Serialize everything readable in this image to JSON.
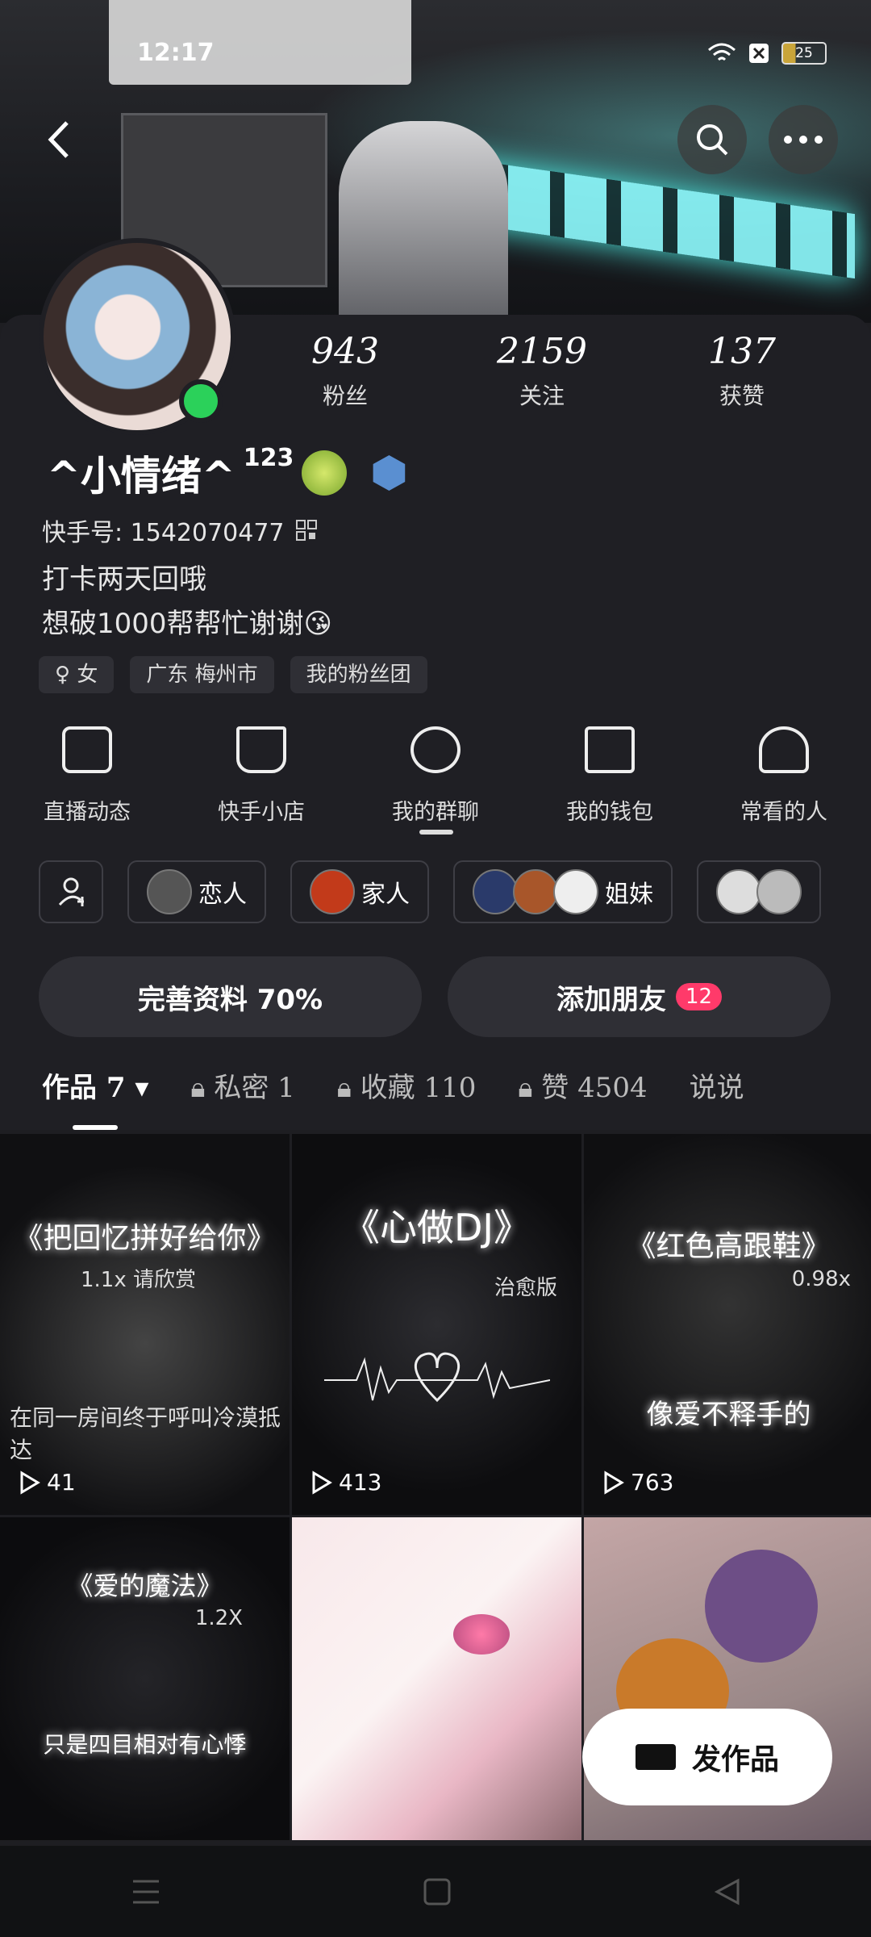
{
  "status": {
    "time": "12:17",
    "battery": "25"
  },
  "profile": {
    "followers_count": "943",
    "followers_label": "粉丝",
    "following_count": "2159",
    "following_label": "关注",
    "likes_count": "137",
    "likes_label": "获赞",
    "name": "^小情绪^",
    "name_suffix": "123",
    "kuaishou_id": "快手号: 1542070477",
    "bio_line1": "打卡两天回哦",
    "bio_line2": "想破1000帮帮忙谢谢😘",
    "tags": [
      "女",
      "广东 梅州市",
      "我的粉丝团"
    ]
  },
  "functions": [
    {
      "label": "直播动态",
      "icon": "live-camera-icon"
    },
    {
      "label": "快手小店",
      "icon": "shopping-cart-icon"
    },
    {
      "label": "我的群聊",
      "icon": "group-chat-icon"
    },
    {
      "label": "我的钱包",
      "icon": "wallet-icon"
    },
    {
      "label": "常看的人",
      "icon": "frequent-person-icon"
    }
  ],
  "groups": [
    {
      "label": "恋人"
    },
    {
      "label": "家人"
    },
    {
      "label": "姐妹"
    }
  ],
  "buttons": {
    "complete_profile": "完善资料 70%",
    "add_friend": "添加朋友",
    "add_friend_badge": "12"
  },
  "tabs": [
    {
      "label": "作品 7"
    },
    {
      "label": "私密 1"
    },
    {
      "label": "收藏 110"
    },
    {
      "label": "赞 4504"
    },
    {
      "label": "说说"
    }
  ],
  "videos": [
    {
      "title": "《把回忆拼好给你》",
      "sub": "1.1x 请欣赏",
      "bottom": "在同一房间终于呼叫冷漠抵达",
      "views": "41"
    },
    {
      "title": "《心做DJ》",
      "sub": "治愈版",
      "bottom": "",
      "views": "413"
    },
    {
      "title": "《红色高跟鞋》",
      "sub": "0.98x",
      "bottom": "像爱不释手的",
      "views": "763"
    },
    {
      "title": "《爱的魔法》",
      "sub": "1.2X",
      "bottom": "只是四目相对有心悸",
      "views": ""
    },
    {
      "title": "",
      "sub": "",
      "bottom": "",
      "views": ""
    },
    {
      "title": "",
      "sub": "",
      "bottom": "",
      "views": ""
    }
  ],
  "fab": {
    "label": "发作品"
  },
  "colors": {
    "background": "#1f1f24",
    "accent": "#ff3a6a",
    "online": "#2bd15a"
  }
}
